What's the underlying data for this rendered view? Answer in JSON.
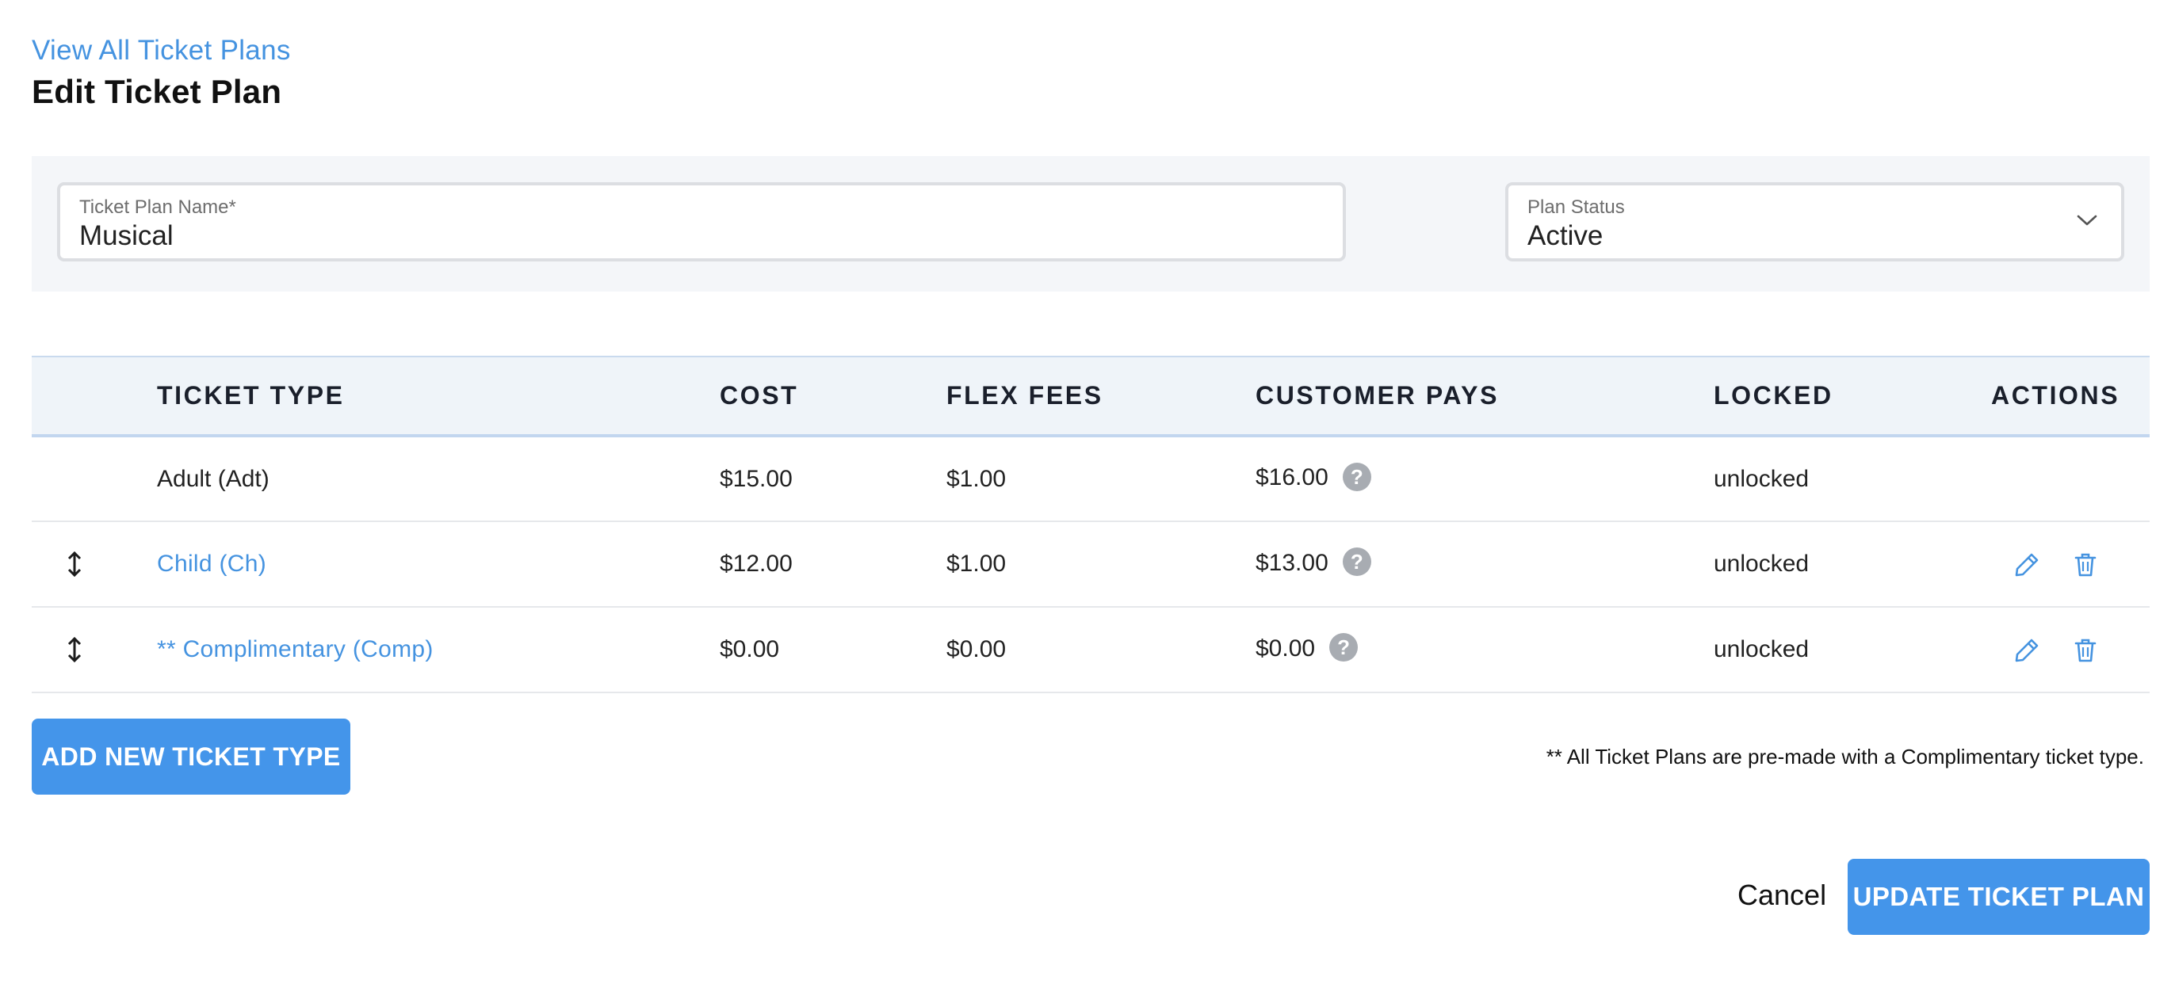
{
  "nav": {
    "back_link": "View All Ticket Plans"
  },
  "page": {
    "title": "Edit Ticket Plan"
  },
  "form": {
    "name_label": "Ticket Plan Name*",
    "name_value": "Musical",
    "status_label": "Plan Status",
    "status_value": "Active"
  },
  "table": {
    "headers": {
      "ticket_type": "TICKET TYPE",
      "cost": "COST",
      "flex_fees": "FLEX FEES",
      "customer_pays": "CUSTOMER PAYS",
      "locked": "LOCKED",
      "actions": "ACTIONS"
    },
    "rows": [
      {
        "ticket_type": "Adult (Adt)",
        "cost": "$15.00",
        "flex_fees": "$1.00",
        "customer_pays": "$16.00",
        "locked": "unlocked",
        "editable": false
      },
      {
        "ticket_type": "Child (Ch)",
        "cost": "$12.00",
        "flex_fees": "$1.00",
        "customer_pays": "$13.00",
        "locked": "unlocked",
        "editable": true
      },
      {
        "ticket_type": "** Complimentary (Comp)",
        "cost": "$0.00",
        "flex_fees": "$0.00",
        "customer_pays": "$0.00",
        "locked": "unlocked",
        "editable": true
      }
    ],
    "help_glyph": "?"
  },
  "buttons": {
    "add_ticket_type": "ADD NEW TICKET TYPE",
    "cancel": "Cancel",
    "update": "UPDATE TICKET PLAN"
  },
  "footnote": "** All Ticket Plans are pre-made with a Complimentary ticket type.",
  "icons": {
    "drag": "drag-handle-icon",
    "help": "help-icon",
    "edit": "pencil-icon",
    "delete": "trash-icon",
    "dropdown": "chevron-down-icon"
  },
  "colors": {
    "accent": "#4593e0",
    "button": "#4495ea",
    "header_bg": "#eff4f9",
    "panel_bg": "#f4f6f9"
  }
}
